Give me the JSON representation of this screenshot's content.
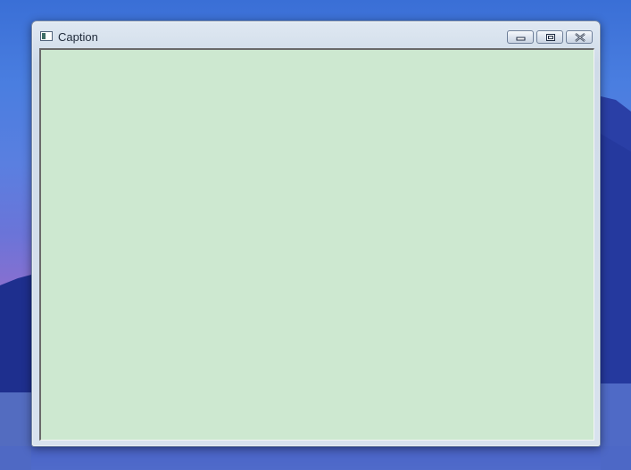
{
  "window": {
    "caption": "Caption",
    "icon": "app-window-icon",
    "controls": {
      "minimize_icon": "minimize-icon",
      "maximize_icon": "maximize-icon",
      "close_icon": "close-icon"
    },
    "client_color": "#cde8d0"
  },
  "desktop": {
    "wallpaper": "blue-mountain-lake"
  }
}
